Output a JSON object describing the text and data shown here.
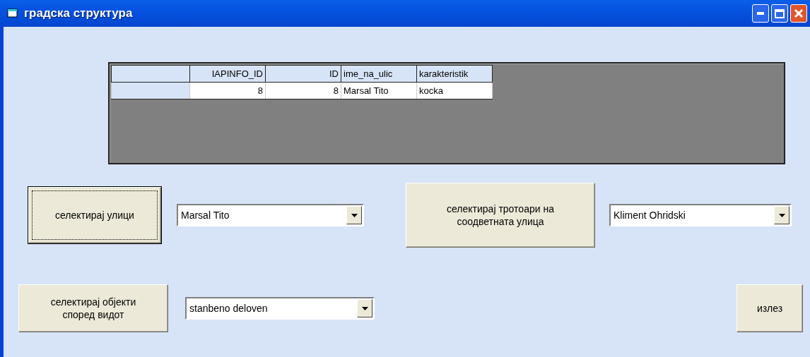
{
  "window": {
    "title": "градска структура"
  },
  "grid": {
    "columns": [
      {
        "label": "IAPINFO_ID",
        "numeric": true
      },
      {
        "label": "ID",
        "numeric": true
      },
      {
        "label": "ime_na_ulic",
        "numeric": false
      },
      {
        "label": "karakteristik",
        "numeric": false
      }
    ],
    "rows": [
      {
        "cells": [
          "8",
          "8",
          "Marsal Tito",
          "kocka"
        ]
      }
    ]
  },
  "controls": [
    {
      "kind": "button",
      "label": "селектирај улици",
      "focused": true
    },
    {
      "kind": "combo",
      "value": "Marsal Tito"
    },
    {
      "kind": "button",
      "label": "селектирај тротоари на соодветната улица",
      "focused": false
    },
    {
      "kind": "combo",
      "value": "Kliment Ohridski"
    },
    {
      "kind": "button",
      "label": "селектирај објекти според видот",
      "focused": false
    },
    {
      "kind": "combo",
      "value": "stanbeno deloven"
    },
    {
      "kind": "button",
      "label": "излез",
      "focused": false
    }
  ]
}
